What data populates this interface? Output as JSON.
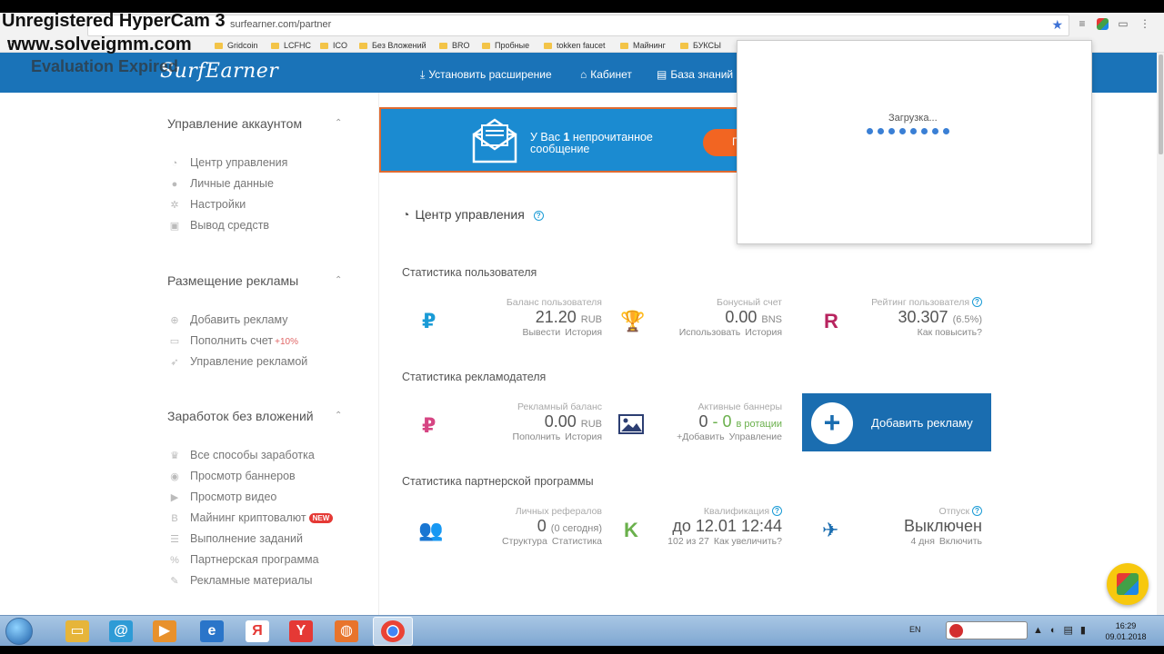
{
  "watermark": {
    "line1": "Unregistered HyperCam 3",
    "line2": "www.solveigmm.com",
    "line3": "Evaluation Expired"
  },
  "browser": {
    "url": "surfearner.com/partner",
    "bookmarks": [
      "Gridcoin",
      "LCFHC",
      "ICO",
      "Без Вложений",
      "BRO",
      "Пробные",
      "tokken faucet",
      "Майнинг",
      "БУКСЫ"
    ]
  },
  "header": {
    "logo": "SurfEarner",
    "nav": [
      "Установить расширение",
      "Кабинет",
      "База знаний"
    ]
  },
  "sidebar": {
    "sections": [
      {
        "title": "Управление аккаунтом",
        "items": [
          "Центр управления",
          "Личные данные",
          "Настройки",
          "Вывод средств"
        ]
      },
      {
        "title": "Размещение рекламы",
        "items": [
          "Добавить рекламу",
          "Пополнить счет",
          "Управление рекламой"
        ],
        "badge": "+10%"
      },
      {
        "title": "Заработок без вложений",
        "items": [
          "Все способы заработка",
          "Просмотр баннеров",
          "Просмотр видео",
          "Майнинг криптовалют",
          "Выполнение заданий",
          "Партнерская программа",
          "Рекламные материалы"
        ],
        "new_label": "NEW"
      }
    ]
  },
  "banner": {
    "text_pre": "У Вас",
    "count": "1",
    "text_post": "непрочитанное сообщение",
    "button_partial": "П"
  },
  "main": {
    "title": "Центр управления",
    "sections": [
      "Статистика пользователя",
      "Статистика рекламодателя",
      "Статистика партнерской программы"
    ],
    "user_stats": [
      {
        "label": "Баланс пользователя",
        "value": "21.20",
        "unit": "RUB",
        "links": [
          "Вывести",
          "История"
        ]
      },
      {
        "label": "Бонусный счет",
        "value": "0.00",
        "unit": "BNS",
        "links": [
          "Использовать",
          "История"
        ]
      },
      {
        "label": "Рейтинг пользователя",
        "value": "30.307",
        "unit": "(6.5%)",
        "links": [
          "Как повысить?"
        ]
      }
    ],
    "advertiser_stats": [
      {
        "label": "Рекламный баланс",
        "value": "0.00",
        "unit": "RUB",
        "links": [
          "Пополнить",
          "История"
        ]
      },
      {
        "label": "Активные баннеры",
        "value_a": "0",
        "sep": " - ",
        "value_b": "0",
        "unit": "в ротации",
        "links": [
          "+Добавить",
          "Управление"
        ]
      }
    ],
    "add_ad_label": "Добавить рекламу",
    "partner_stats": [
      {
        "label": "Личных рефералов",
        "value": "0",
        "unit": "(0 сегодня)",
        "links": [
          "Структура",
          "Статистика"
        ]
      },
      {
        "label": "Квалификация",
        "value": "до 12.01 12:44",
        "links": [
          "102 из 27",
          "Как увеличить?"
        ]
      },
      {
        "label": "Отпуск",
        "value": "Выключен",
        "links": [
          "4 дня",
          "Включить"
        ]
      }
    ]
  },
  "popup": {
    "loading": "Загрузка..."
  },
  "taskbar": {
    "lang": "EN",
    "time": "16:29",
    "date": "09.01.2018"
  },
  "colors": {
    "header": "#1a73b8",
    "accent_orange": "#f26522",
    "ruble_blue": "#1a9bd6",
    "ruble_pink": "#d64583",
    "trophy": "#e0b40b",
    "rating": "#b8245f",
    "referrals": "#f0903a",
    "green": "#6ab04c",
    "plane": "#1a6db0"
  }
}
